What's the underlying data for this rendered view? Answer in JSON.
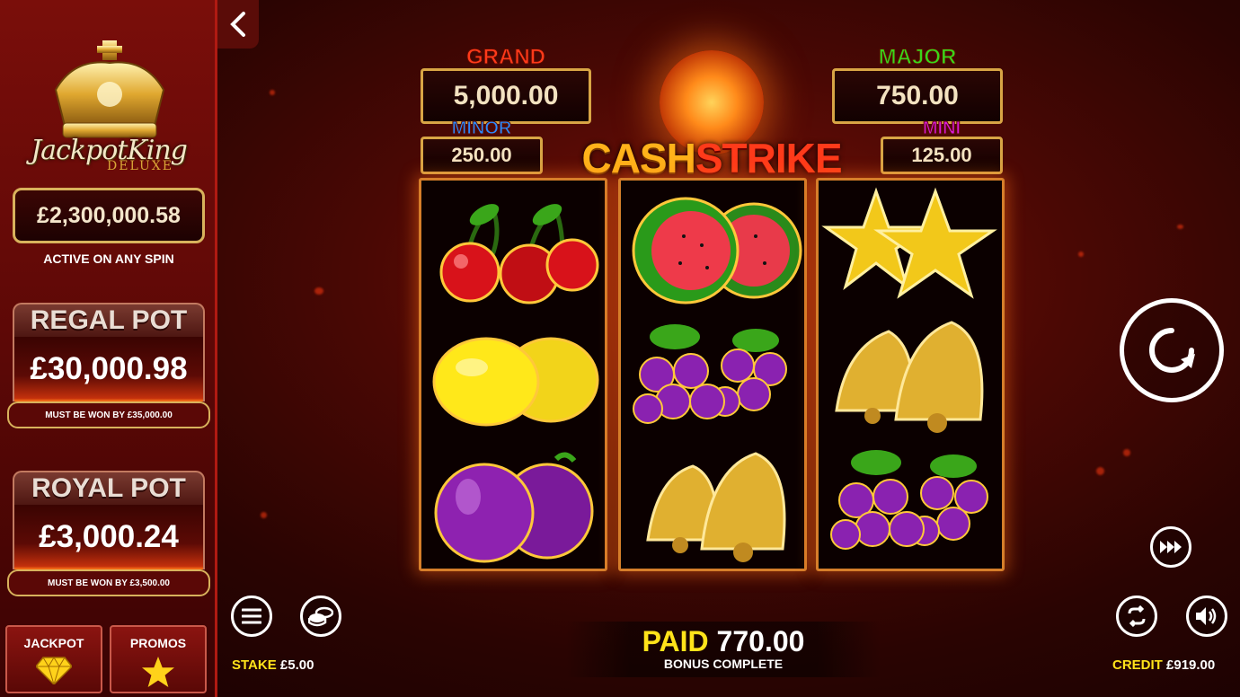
{
  "colors": {
    "gold": "#d8b25c",
    "accent_yellow": "#ffe31a",
    "sidebar_red": "#7a0e0a"
  },
  "sidebar": {
    "logo": {
      "title": "JackpotKing",
      "subtitle": "DELUXE"
    },
    "jackpot_amount": "£2,300,000.58",
    "active_text": "ACTIVE ON ANY SPIN",
    "regal_pot": {
      "title": "REGAL POT",
      "value": "£30,000.98",
      "must_be_won": "MUST BE WON BY £35,000.00"
    },
    "royal_pot": {
      "title": "ROYAL POT",
      "value": "£3,000.24",
      "must_be_won": "MUST BE WON BY £3,500.00"
    },
    "buttons": [
      {
        "label": "JACKPOT",
        "icon": "diamond-icon"
      },
      {
        "label": "PROMOS",
        "icon": "star-icon"
      }
    ]
  },
  "jackpots": {
    "grand": {
      "label": "GRAND",
      "value": "5,000.00",
      "color": "#ff3a1a"
    },
    "major": {
      "label": "MAJOR",
      "value": "750.00",
      "color": "#3ad61a"
    },
    "minor": {
      "label": "MINOR",
      "value": "250.00",
      "color": "#2a8aff"
    },
    "mini": {
      "label": "MINI",
      "value": "125.00",
      "color": "#d81ad8"
    }
  },
  "logo": {
    "part1": "CASH",
    "part2": "STRIKE"
  },
  "reels": [
    [
      "cherries",
      "lemons",
      "plums"
    ],
    [
      "watermelons",
      "grapes",
      "bells"
    ],
    [
      "stars",
      "bells",
      "grapes"
    ]
  ],
  "footer": {
    "stake_label": "STAKE",
    "stake_value": "£5.00",
    "paid_label": "PAID",
    "paid_value": "770.00",
    "status": "BONUS COMPLETE",
    "credit_label": "CREDIT",
    "credit_value": "£919.00"
  },
  "icons": [
    "back-chevron-icon",
    "menu-icon",
    "coins-icon",
    "spin-icon",
    "fast-forward-icon",
    "autoplay-icon",
    "sound-icon"
  ]
}
